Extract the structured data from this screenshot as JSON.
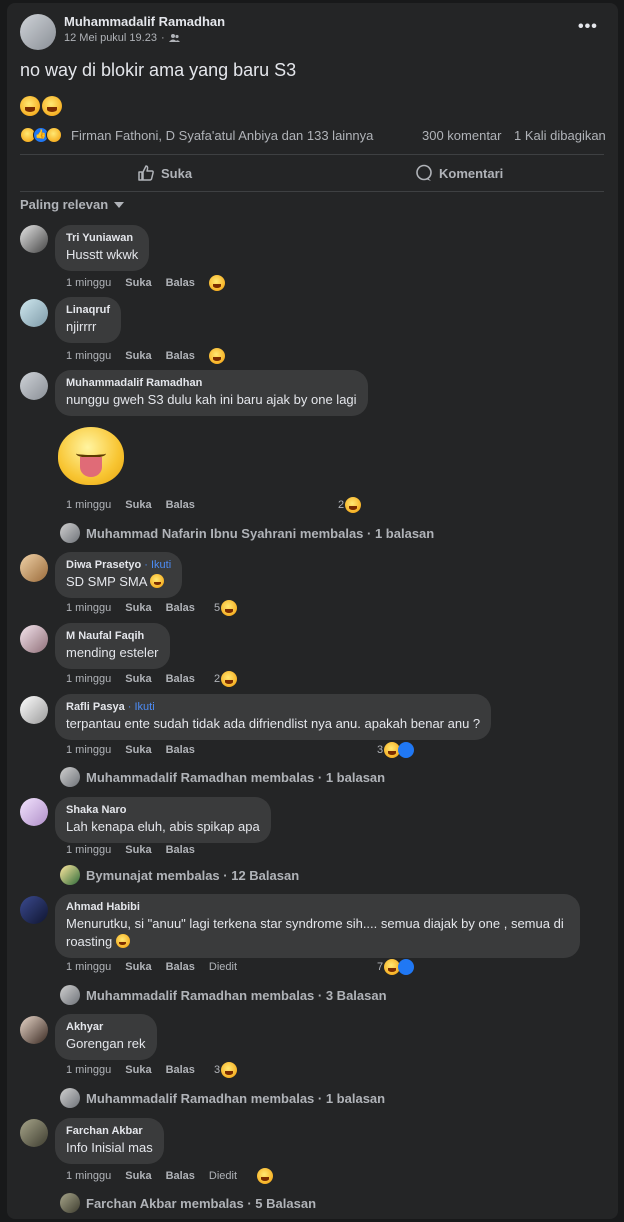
{
  "post": {
    "author": "Muhammadalif Ramadhan",
    "timestamp": "12 Mei pukul 19.23",
    "audience_icon": "friends-icon",
    "text": "no way di blokir ama yang baru S3",
    "reactions_summary": "Firman Fathoni, D Syafa'atul Anbiya dan 133 lainnya",
    "comments_count": "300 komentar",
    "shares_count": "1 Kali dibagikan",
    "like_label": "Suka",
    "comment_label": "Komentari",
    "sort_label": "Paling relevan"
  },
  "comments": [
    {
      "name": "Tri Yuniawan",
      "text": "Husstt wkwk",
      "time": "1 minggu",
      "like": "Suka",
      "reply": "Balas"
    },
    {
      "name": "Linaqruf",
      "text": "njirrrr",
      "time": "1 minggu",
      "like": "Suka",
      "reply": "Balas"
    },
    {
      "name": "Muhammadalif Ramadhan",
      "text": "nunggu gweh S3 dulu kah ini baru ajak by one lagi",
      "time": "1 minggu",
      "like": "Suka",
      "reply": "Balas",
      "reactions": "2",
      "replies": "Muhammad Nafarin Ibnu Syahrani membalas · 1 balasan"
    },
    {
      "name": "Diwa Prasetyo",
      "follow": " · Ikuti",
      "text": "SD SMP SMA",
      "time": "1 minggu",
      "like": "Suka",
      "reply": "Balas",
      "reactions": "5"
    },
    {
      "name": "M Naufal Faqih",
      "text": "mending esteler",
      "time": "1 minggu",
      "like": "Suka",
      "reply": "Balas",
      "reactions": "2"
    },
    {
      "name": "Rafli Pasya",
      "follow": " · Ikuti",
      "text": "terpantau ente sudah tidak ada difriendlist nya anu. apakah benar anu ?",
      "time": "1 minggu",
      "like": "Suka",
      "reply": "Balas",
      "reactions": "3",
      "replies": "Muhammadalif Ramadhan membalas · 1 balasan"
    },
    {
      "name": "Shaka Naro",
      "text": "Lah kenapa eluh, abis spikap apa",
      "time": "1 minggu",
      "like": "Suka",
      "reply": "Balas",
      "replies": "Bymunajat membalas · 12 Balasan"
    },
    {
      "name": "Ahmad Habibi",
      "text": "Menurutku, si \"anuu\" lagi terkena star syndrome sih.... semua diajak by one , semua di roasting",
      "time": "1 minggu",
      "like": "Suka",
      "reply": "Balas",
      "edited": "Diedit",
      "reactions": "7",
      "replies": "Muhammadalif Ramadhan membalas · 3 Balasan"
    },
    {
      "name": "Akhyar",
      "text": "Gorengan rek",
      "time": "1 minggu",
      "like": "Suka",
      "reply": "Balas",
      "reactions": "3",
      "replies": "Muhammadalif Ramadhan membalas · 1 balasan"
    },
    {
      "name": "Farchan Akbar",
      "text": "Info Inisial mas",
      "time": "1 minggu",
      "like": "Suka",
      "reply": "Balas",
      "edited": "Diedit",
      "replies": "Farchan Akbar membalas · 5 Balasan"
    }
  ]
}
